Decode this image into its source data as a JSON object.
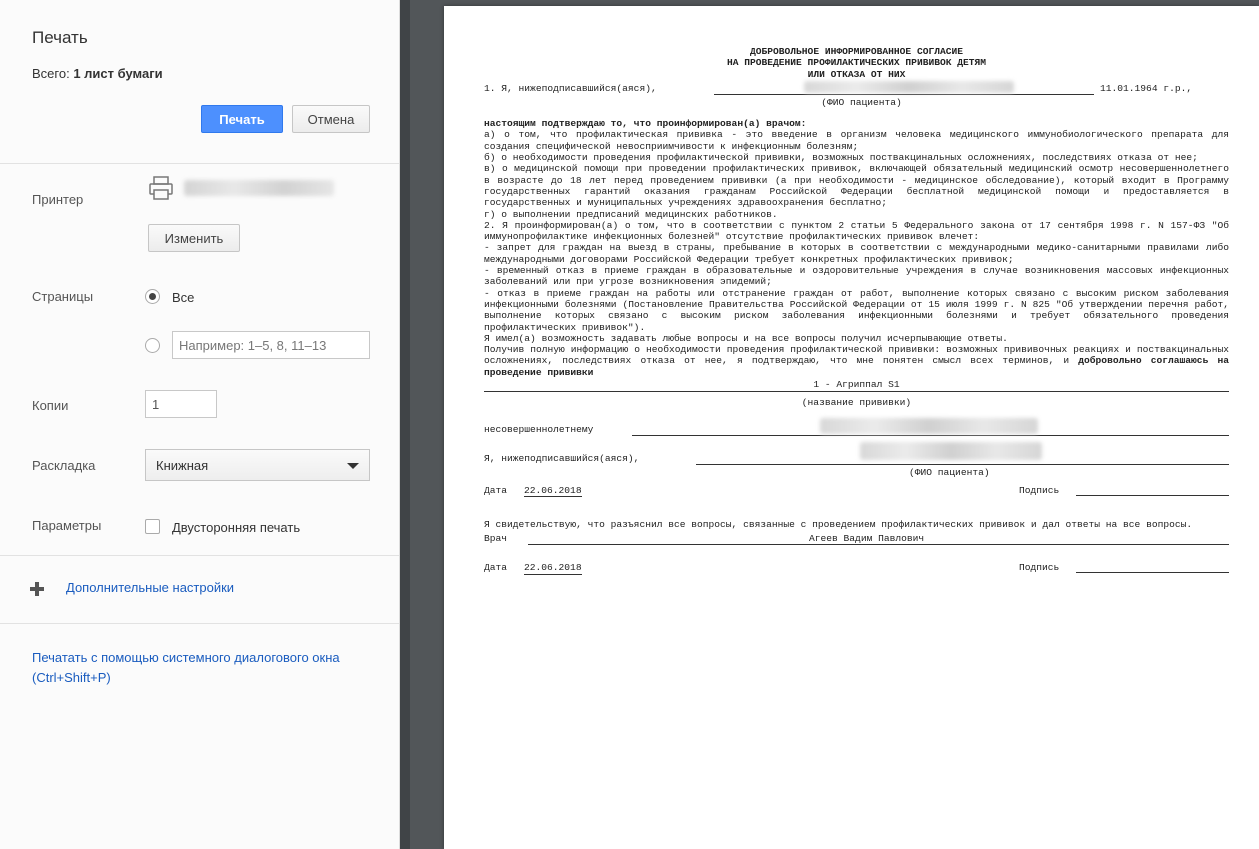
{
  "sidebar": {
    "title": "Печать",
    "total_label": "Всего:",
    "total_value": "1 лист бумаги",
    "print_button": "Печать",
    "cancel_button": "Отмена",
    "printer_label": "Принтер",
    "change_button": "Изменить",
    "pages_label": "Страницы",
    "pages_all": "Все",
    "pages_placeholder": "Например: 1–5, 8, 11–13",
    "copies_label": "Копии",
    "copies_value": "1",
    "layout_label": "Раскладка",
    "layout_value": "Книжная",
    "options_label": "Параметры",
    "duplex_label": "Двусторонняя печать",
    "more_settings": "Дополнительные настройки",
    "system_dialog": "Печатать с помощью системного диалогового окна (Ctrl+Shift+P)"
  },
  "document": {
    "title1": "ДОБРОВОЛЬНОЕ ИНФОРМИРОВАННОЕ СОГЛАСИЕ",
    "title2": "НА ПРОВЕДЕНИЕ ПРОФИЛАКТИЧЕСКИХ ПРИВИВОК ДЕТЯМ",
    "title3": "ИЛИ ОТКАЗА ОТ НИХ",
    "line1_prefix": "1. Я, нижеподписавшийся(аяся),",
    "birth_date": "11.01.1964 г.р.,",
    "fio_caption": "(ФИО пациента)",
    "confirm_heading": "настоящим подтверждаю то, что проинформирован(а) врачом:",
    "para_a": "а) о том, что профилактическая прививка - это введение в организм человека медицинского иммунобиологического препарата для создания специфической невосприимчивости к инфекционным болезням;",
    "para_b": "б) о необходимости проведения профилактической прививки, возможных поствакцинальных осложнениях, последствиях отказа от нее;",
    "para_v": "в) о медицинской помощи при проведении профилактических прививок, включающей обязательный медицинский осмотр несовершеннолетнего в возрасте до 18 лет перед проведением прививки (а при необходимости - медицинское обследование), который входит в Программу государственных гарантий оказания гражданам Российской Федерации бесплатной медицинской помощи и предоставляется в государственных и муниципальных учреждениях здравоохранения бесплатно;",
    "para_g": "г) о выполнении предписаний медицинских работников.",
    "para_2": "2. Я проинформирован(а) о том, что в соответствии с пунктом 2 статьи 5 Федерального закона от 17 сентября 1998 г. N 157-ФЗ \"Об иммунопрофилактике инфекционных болезней\" отсутствие профилактических прививок влечет:",
    "dash_1": "- запрет для граждан на выезд в страны, пребывание в которых в соответствии с международными медико-санитарными правилами либо международными договорами Российской Федерации требует конкретных профилактических прививок;",
    "dash_2": "- временный отказ в приеме граждан в образовательные и оздоровительные учреждения в случае возникновения массовых инфекционных заболеваний или при угрозе возникновения эпидемий;",
    "dash_3": "- отказ в приеме граждан на работы или отстранение граждан от работ, выполнение которых связано с высоким риском заболевания инфекционными болезнями (Постановление Правительства Российской Федерации от 15 июля 1999 г. N 825 \"Об утверждении перечня работ, выполнение которых связано с высоким риском заболевания инфекционными болезнями и требует обязательного проведения профилактических прививок\").",
    "para_questions": "Я имел(а) возможность задавать любые вопросы и на все вопросы получил исчерпывающие ответы.",
    "para_final": "Получив полную информацию о необходимости проведения профилактической прививки: возможных прививочных реакциях и поствакцинальных осложнениях, последствиях отказа от нее, я подтверждаю, что мне понятен смысл всех терминов, и",
    "para_final_bold": "добровольно соглашаюсь на проведение прививки",
    "vaccine": "1 - Агриппал S1",
    "vaccine_caption": "(название прививки)",
    "minor_label": "несовершеннолетнему",
    "signer_label": "Я, нижеподписавшийся(аяся),",
    "signer_caption": "(ФИО пациента)",
    "date_label": "Дата",
    "date_value": "22.06.2018",
    "signature_label": "Подпись",
    "certify_text": "Я свидетельствую, что разъяснил все вопросы, связанные с проведением профилактических прививок и дал ответы на все вопросы.",
    "doctor_label": "Врач",
    "doctor_name": "Агеев Вадим Павлович",
    "date2_label": "Дата",
    "date2_value": "22.06.2018",
    "signature2_label": "Подпись"
  },
  "colors": {
    "primary_button": "#4d90fe",
    "link": "#1a5cbf",
    "preview_bg": "#525659"
  }
}
